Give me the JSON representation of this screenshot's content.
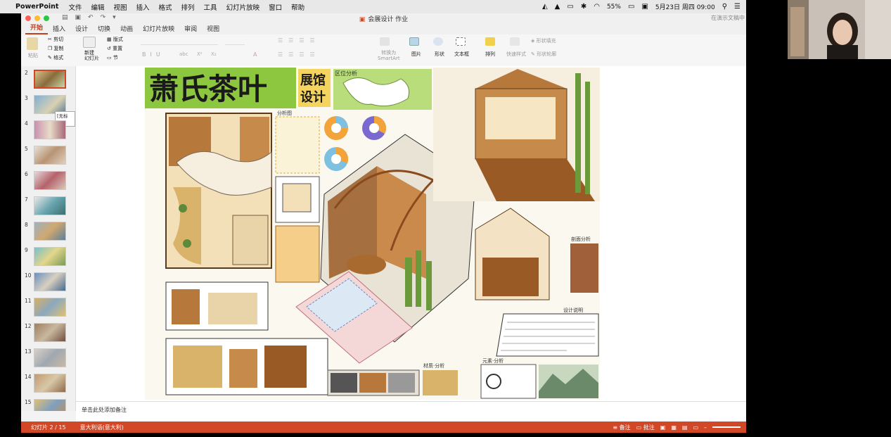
{
  "menubar": {
    "app_name": "PowerPoint",
    "items": [
      "文件",
      "编辑",
      "视图",
      "插入",
      "格式",
      "排列",
      "工具",
      "幻灯片放映",
      "窗口",
      "帮助"
    ],
    "battery": "55%",
    "datetime": "5月23日 周四 09:00"
  },
  "window": {
    "title": "会展设计 作业",
    "search_placeholder": "在演示文稿中"
  },
  "tabs": [
    "开始",
    "插入",
    "设计",
    "切换",
    "动画",
    "幻灯片放映",
    "审阅",
    "视图"
  ],
  "ribbon": {
    "paste": "粘贴",
    "cut": "剪切",
    "copy": "复制",
    "format": "格式",
    "new_slide": "新建\n幻灯片",
    "layout": "版式",
    "reset": "重置",
    "section": "节",
    "convert_smartart": "转换为\nSmartArt",
    "picture": "图片",
    "shape": "形状",
    "textbox": "文本框",
    "arrange": "排列",
    "quick_styles": "快速样式",
    "shape_fill": "形状填充",
    "shape_outline": "形状轮廓"
  },
  "thumbnails": {
    "numbers": [
      "2",
      "3",
      "4",
      "5",
      "6",
      "7",
      "8",
      "9",
      "10",
      "11",
      "12",
      "13",
      "14",
      "15"
    ],
    "active": "2",
    "tooltip": "[无标题]"
  },
  "slide": {
    "title_main": "萧氏茶叶",
    "title_side_1": "展馆",
    "title_side_2": "设计",
    "label_location": "区位分析",
    "label_analysis": "分析图",
    "label_material": "材质·分析",
    "label_symbol": "元素·分析",
    "label_design": "设计说明",
    "label_section": "剖面分析"
  },
  "notes": {
    "placeholder": "单击此处添加备注"
  },
  "status": {
    "slide_counter": "幻灯片 2 / 15",
    "language": "意大利语(意大利)",
    "notes_btn": "备注",
    "comments_btn": "批注"
  },
  "colors": {
    "accent": "#d24726",
    "title_green": "#8dc63f",
    "wood": "#9a5a26"
  }
}
